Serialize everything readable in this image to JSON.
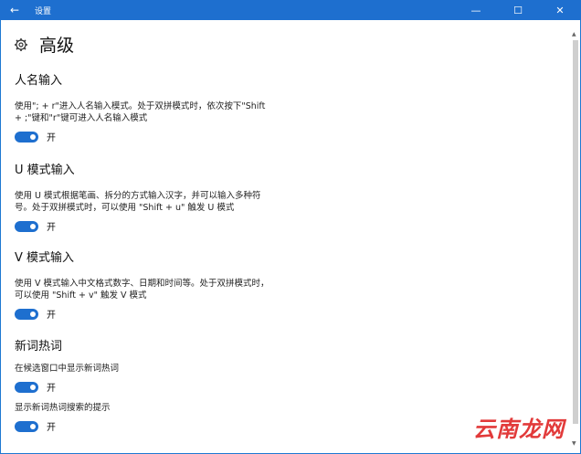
{
  "window": {
    "title": "设置"
  },
  "page": {
    "title": "高级"
  },
  "sections": [
    {
      "title": "人名输入",
      "desc": [
        "使用\"; + r\"进入人名输入模式。处于双拼模式时，依次按下\"Shift",
        "+ ;\"键和\"r\"键可进入人名输入模式"
      ],
      "toggle": "开"
    },
    {
      "title": "U 模式输入",
      "desc": [
        "使用 U 模式根据笔画、拆分的方式输入汉字，并可以输入多种符",
        "号。处于双拼模式时，可以使用 \"Shift + u\" 触发 U 模式"
      ],
      "toggle": "开"
    },
    {
      "title": "V 模式输入",
      "desc": [
        "使用 V 模式输入中文格式数字、日期和时间等。处于双拼模式时，",
        "可以使用 \"Shift + v\" 触发 V 模式"
      ],
      "toggle": "开"
    },
    {
      "title": "新词热词",
      "items": [
        {
          "desc": "在候选窗口中显示新词热词",
          "toggle": "开"
        },
        {
          "desc": "显示新词热词搜索的提示",
          "toggle": "开"
        }
      ]
    }
  ],
  "watermark": "云南龙网",
  "colors": {
    "accent": "#1e6fcf"
  },
  "icons": {
    "back": "back-arrow-icon",
    "settings": "gear-icon"
  }
}
